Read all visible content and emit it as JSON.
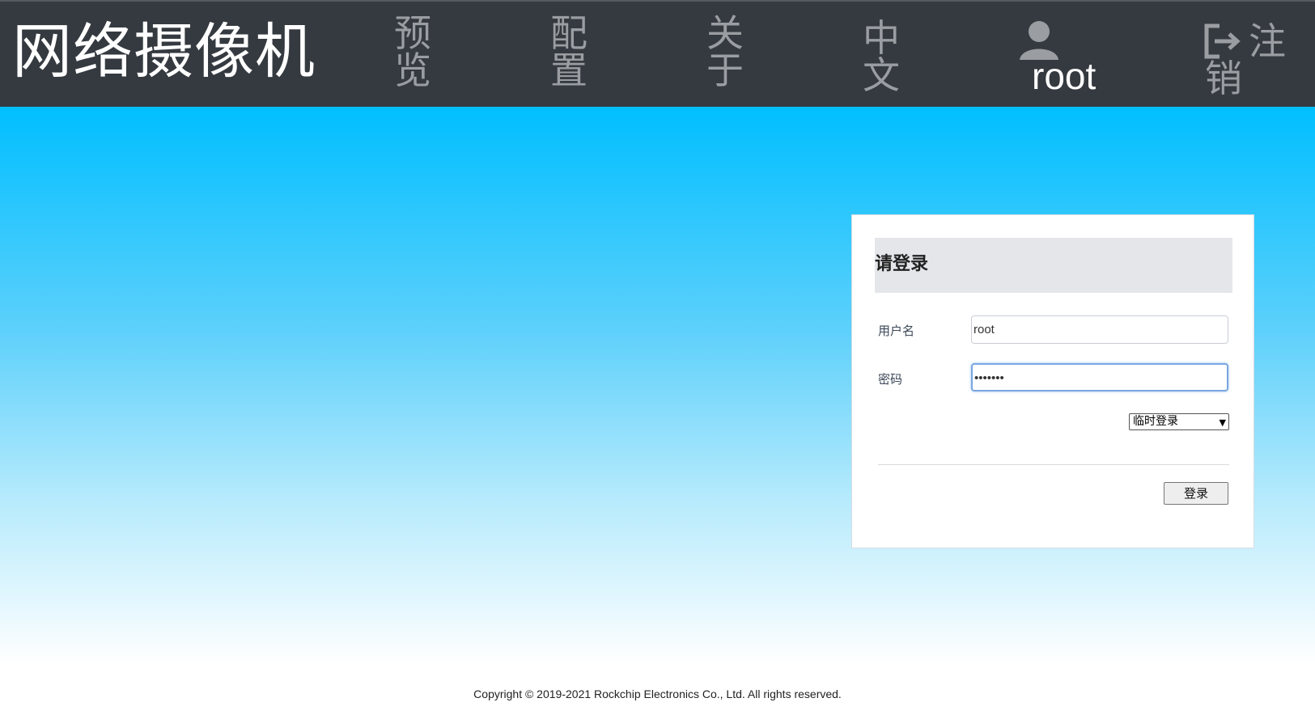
{
  "header": {
    "brand": "网络摄像机",
    "nav": {
      "preview": "预览",
      "config": "配置",
      "about": "关于",
      "language": "中文"
    },
    "user": {
      "name": "root",
      "icon": "user-icon"
    },
    "logout": {
      "line1": "注",
      "line2": "销",
      "icon": "logout-icon"
    }
  },
  "login": {
    "title": "请登录",
    "username_label": "用户名",
    "username_value": "root",
    "password_label": "密码",
    "password_value": "•••••••",
    "mode_selected": "临时登录",
    "submit_label": "登录"
  },
  "footer": {
    "copyright": "Copyright © 2019-2021 Rockchip Electronics Co., Ltd. All rights reserved."
  },
  "colors": {
    "topbar": "#353a40",
    "nav_text": "#9a9da1",
    "gradient_top": "#00bfff",
    "gradient_bottom": "#ffffff"
  }
}
